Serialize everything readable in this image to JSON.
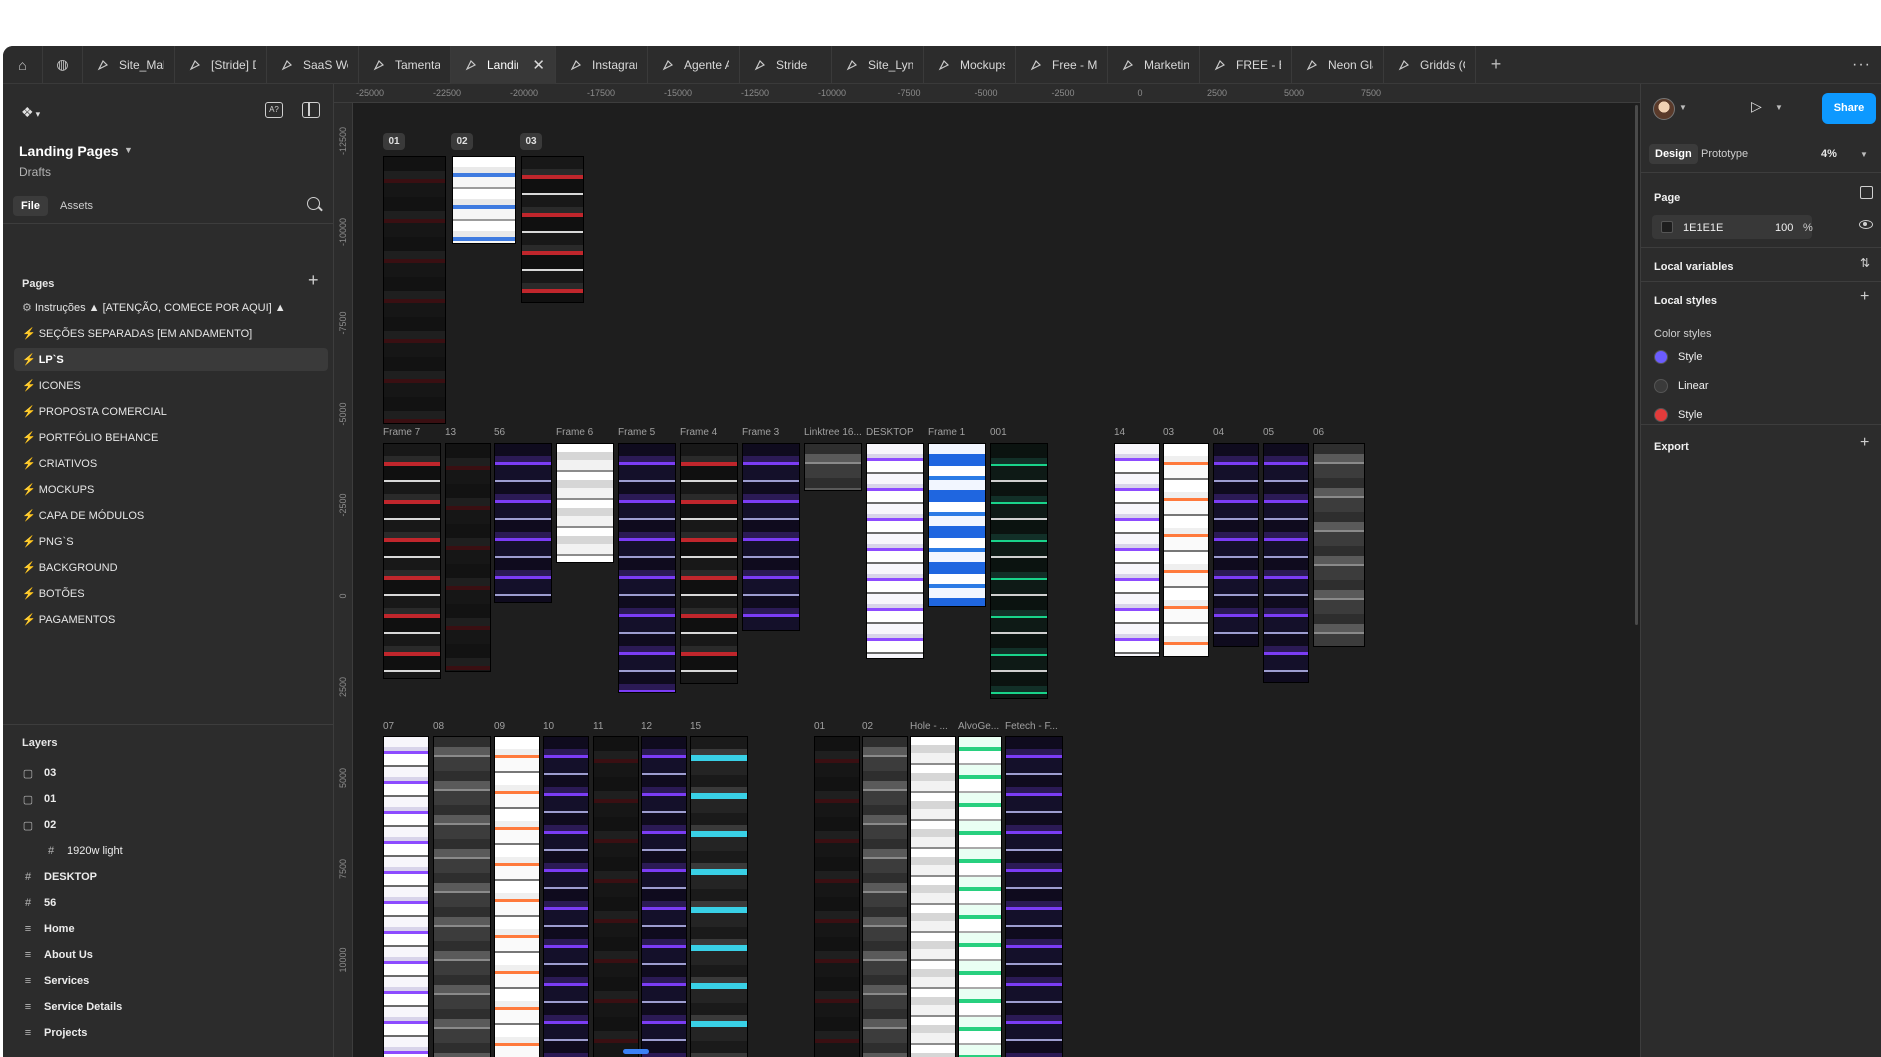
{
  "tabs": [
    {
      "label": "Site_Malbor",
      "active": false
    },
    {
      "label": "[Stride] Des",
      "active": false
    },
    {
      "label": "SaaS Websi",
      "active": false
    },
    {
      "label": "Tamentai - [",
      "active": false
    },
    {
      "label": "Landing",
      "active": true
    },
    {
      "label": "Instagram U",
      "active": false
    },
    {
      "label": "Agente AI",
      "active": false
    },
    {
      "label": "Stride",
      "active": false
    },
    {
      "label": "Site_Lynz D",
      "active": false
    },
    {
      "label": "Mockups Le",
      "active": false
    },
    {
      "label": "Free - Mark",
      "active": false
    },
    {
      "label": "Marketing ic",
      "active": false
    },
    {
      "label": "FREE - Busi",
      "active": false
    },
    {
      "label": "Neon Glass",
      "active": false
    },
    {
      "label": "Gridds (Com",
      "active": false
    }
  ],
  "tabbar": {
    "close_glyph": "✕",
    "plus_glyph": "+",
    "more_glyph": "···",
    "home_icon": "home-icon",
    "globe_icon": "globe-icon"
  },
  "left_panel": {
    "file_title": "Landing Pages",
    "file_subtitle": "Drafts",
    "file_tab": "File",
    "assets_tab": "Assets",
    "pages_title": "Pages",
    "pages": [
      {
        "label": "Instruções ▲ [ATENÇÃO, COMECE POR AQUI] ▲",
        "icon": "gear-icon",
        "selected": false
      },
      {
        "label": "SEÇÕES SEPARADAS  [EM ANDAMENTO]",
        "icon": "bolt-icon",
        "selected": false
      },
      {
        "label": "LP`S",
        "icon": "bolt-icon",
        "selected": true
      },
      {
        "label": "ICONES",
        "icon": "bolt-icon",
        "selected": false
      },
      {
        "label": "PROPOSTA COMERCIAL",
        "icon": "bolt-icon",
        "selected": false
      },
      {
        "label": "PORTFÓLIO BEHANCE",
        "icon": "bolt-icon",
        "selected": false
      },
      {
        "label": "CRIATIVOS",
        "icon": "bolt-icon",
        "selected": false
      },
      {
        "label": "MOCKUPS",
        "icon": "bolt-icon",
        "selected": false
      },
      {
        "label": "CAPA DE MÓDULOS",
        "icon": "bolt-icon",
        "selected": false
      },
      {
        "label": "PNG`S",
        "icon": "bolt-icon",
        "selected": false
      },
      {
        "label": "BACKGROUND",
        "icon": "bolt-icon",
        "selected": false
      },
      {
        "label": "BOTÕES",
        "icon": "bolt-icon",
        "selected": false
      },
      {
        "label": "PAGAMENTOS",
        "icon": "bolt-icon",
        "selected": false
      }
    ],
    "layers_title": "Layers",
    "layers": [
      {
        "label": "03",
        "icon": "frame-icon",
        "sub": false
      },
      {
        "label": "01",
        "icon": "frame-icon",
        "sub": false
      },
      {
        "label": "02",
        "icon": "frame-icon",
        "sub": false
      },
      {
        "label": "1920w light",
        "icon": "grid-icon",
        "sub": true
      },
      {
        "label": "DESKTOP",
        "icon": "hash-icon",
        "sub": false
      },
      {
        "label": "56",
        "icon": "hash-icon",
        "sub": false
      },
      {
        "label": "Home",
        "icon": "section-icon",
        "sub": false
      },
      {
        "label": "About Us",
        "icon": "section-icon",
        "sub": false
      },
      {
        "label": "Services",
        "icon": "section-icon",
        "sub": false
      },
      {
        "label": "Service Details",
        "icon": "section-icon",
        "sub": false
      },
      {
        "label": "Projects",
        "icon": "section-icon",
        "sub": false
      }
    ]
  },
  "rulers": {
    "horizontal": [
      "-25000",
      "-22500",
      "-20000",
      "-17500",
      "-15000",
      "-12500",
      "-10000",
      "-7500",
      "-5000",
      "-2500",
      "0",
      "2500",
      "5000",
      "7500"
    ],
    "vertical": [
      "-12500",
      "-10000",
      "-7500",
      "-5000",
      "-2500",
      "0",
      "2500",
      "5000",
      "7500",
      "10000"
    ]
  },
  "canvas": {
    "badges": [
      "01",
      "02",
      "03"
    ],
    "row2_labels": [
      "Frame 7",
      "13",
      "56",
      "Frame 6",
      "Frame 5",
      "Frame 4",
      "Frame 3",
      "Linktree 16...",
      "DESKTOP",
      "Frame 1",
      "001",
      "14",
      "03",
      "04",
      "05",
      "06"
    ],
    "row3_labels": [
      "07",
      "08",
      "09",
      "10",
      "11",
      "12",
      "15",
      "01",
      "02",
      "Hole - ...",
      "AlvoGe...",
      "Fetech - F..."
    ]
  },
  "right_panel": {
    "share_label": "Share",
    "design_tab": "Design",
    "prototype_tab": "Prototype",
    "zoom": "4%",
    "page_title": "Page",
    "page_color_hex": "1E1E1E",
    "page_opacity": "100",
    "page_opacity_unit": "%",
    "local_variables": "Local variables",
    "local_styles": "Local styles",
    "color_styles_title": "Color styles",
    "color_styles": [
      {
        "label": "Style",
        "color": "#6b5cff"
      },
      {
        "label": "Linear",
        "color": "#3a3a3a"
      },
      {
        "label": "Style",
        "color": "#e23b3b"
      }
    ],
    "export_title": "Export"
  },
  "colors": {
    "accent": "#0d99ff",
    "canvas_bg": "#1e1e1e",
    "panel_bg": "#2c2c2c"
  }
}
